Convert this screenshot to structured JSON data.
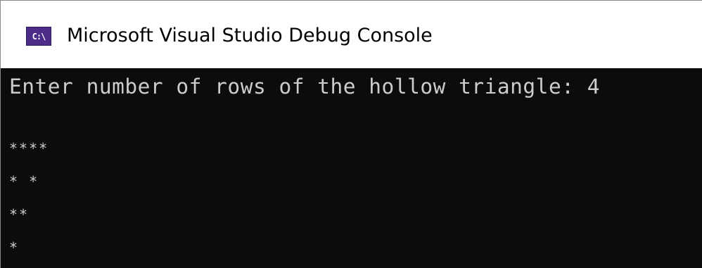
{
  "window": {
    "title": "Microsoft Visual Studio Debug Console",
    "icon": "console-app-icon",
    "icon_text": "C:\\"
  },
  "console": {
    "prompt": "Enter number of rows of the hollow triangle: 4",
    "output_lines": [
      "****",
      "* *",
      "**",
      "*"
    ],
    "background_color": "#0c0c0c",
    "text_color": "#cccccc"
  }
}
